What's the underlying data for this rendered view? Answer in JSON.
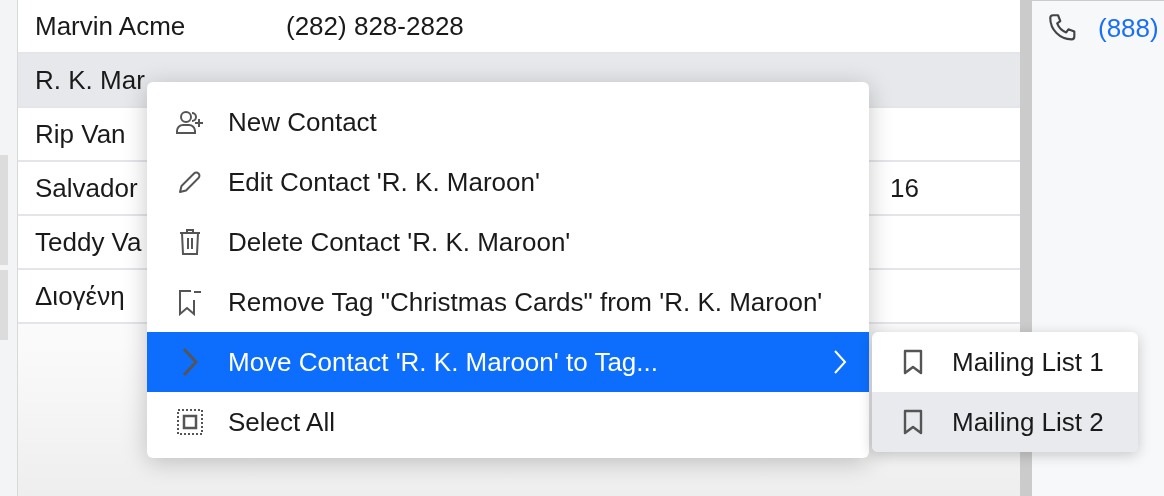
{
  "contacts": {
    "rows": [
      {
        "name": "Marvin Acme",
        "phone": "(282) 828-2828",
        "selected": false
      },
      {
        "name": "R. K. Mar",
        "selected": true
      },
      {
        "name": "Rip Van",
        "selected": false
      },
      {
        "name": "Salvador",
        "column_3": "16",
        "selected": false
      },
      {
        "name": "Teddy Va",
        "selected": false
      },
      {
        "name": "Διογένη",
        "selected": false
      }
    ]
  },
  "details": {
    "phone": "(888)"
  },
  "context_menu": {
    "items": [
      {
        "label": "New Contact",
        "selected": false,
        "submenu": false
      },
      {
        "label": "Edit Contact 'R. K. Maroon'",
        "selected": false,
        "submenu": false
      },
      {
        "label": "Delete Contact 'R. K. Maroon'",
        "selected": false,
        "submenu": false
      },
      {
        "label": "Remove Tag \"Christmas Cards\" from 'R. K. Maroon'",
        "selected": false,
        "submenu": false
      },
      {
        "label": "Move Contact 'R. K. Maroon' to Tag...",
        "selected": true,
        "submenu": true
      },
      {
        "label": "Select All",
        "selected": false,
        "submenu": false
      }
    ]
  },
  "submenu": {
    "items": [
      {
        "label": "Mailing List 1",
        "selected": false
      },
      {
        "label": "Mailing List 2",
        "selected": true
      }
    ]
  }
}
